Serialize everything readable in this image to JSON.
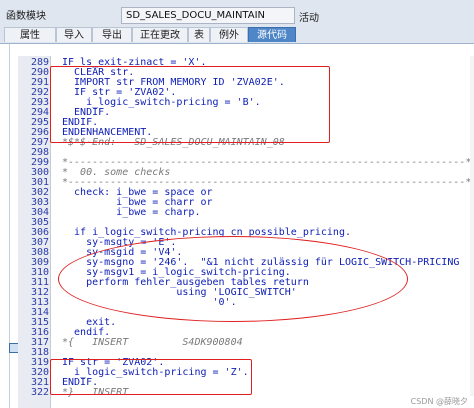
{
  "header": {
    "label": "函数模块",
    "function_name": "SD_SALES_DOCU_MAINTAIN",
    "status": "活动"
  },
  "tabs": [
    "属性",
    "导入",
    "导出",
    "正在更改",
    "表",
    "例外",
    "源代码"
  ],
  "active_tab": "源代码",
  "code_lines": [
    {
      "n": "289",
      "t": "IF ls_exit-zinact = 'X'."
    },
    {
      "n": "290",
      "t": "  CLEAR str."
    },
    {
      "n": "291",
      "t": "  IMPORT str FROM MEMORY ID 'ZVA02E'."
    },
    {
      "n": "292",
      "t": "  IF str = 'ZVA02'."
    },
    {
      "n": "293",
      "t": "    i_logic_switch-pricing = 'B'."
    },
    {
      "n": "294",
      "t": "  ENDIF."
    },
    {
      "n": "295",
      "t": "ENDIF."
    },
    {
      "n": "296",
      "t": "ENDENHANCEMENT."
    },
    {
      "n": "297",
      "t": "*$*$-End:   SD_SALES_DOCU_MAINTAIN_08"
    },
    {
      "n": "298",
      "t": ""
    },
    {
      "n": "299",
      "t": "*------------------------------------------------------------------*"
    },
    {
      "n": "300",
      "t": "*  00. some checks"
    },
    {
      "n": "301",
      "t": "*------------------------------------------------------------------*"
    },
    {
      "n": "302",
      "t": "  check: i_bwe = space or"
    },
    {
      "n": "303",
      "t": "         i_bwe = charr or"
    },
    {
      "n": "304",
      "t": "         i_bwe = charp."
    },
    {
      "n": "305",
      "t": ""
    },
    {
      "n": "306",
      "t": "  if i_logic_switch-pricing cn possible_pricing."
    },
    {
      "n": "307",
      "t": "    sy-msgty = 'E'."
    },
    {
      "n": "308",
      "t": "    sy-msgid = 'V4'."
    },
    {
      "n": "309",
      "t": "    sy-msgno = '246'.  \"&1 nicht zulässig für LOGIC_SWITCH-PRICING"
    },
    {
      "n": "310",
      "t": "    sy-msgv1 = i_logic_switch-pricing."
    },
    {
      "n": "311",
      "t": "    perform fehler_ausgeben tables return"
    },
    {
      "n": "312",
      "t": "                   using 'LOGIC_SWITCH'"
    },
    {
      "n": "313",
      "t": "                         '0'."
    },
    {
      "n": "314",
      "t": ""
    },
    {
      "n": "315",
      "t": "    exit."
    },
    {
      "n": "316",
      "t": "  endif."
    },
    {
      "n": "317",
      "t": "*{   INSERT         S4DK900804                                        2"
    },
    {
      "n": "318",
      "t": ""
    },
    {
      "n": "319",
      "t": "IF str = 'ZVA02'."
    },
    {
      "n": "320",
      "t": "  i_logic_switch-pricing = 'Z'."
    },
    {
      "n": "321",
      "t": "ENDIF."
    },
    {
      "n": "322",
      "t": "*}   INSERT"
    }
  ],
  "footer_text": "CSDN @薛晓夕"
}
